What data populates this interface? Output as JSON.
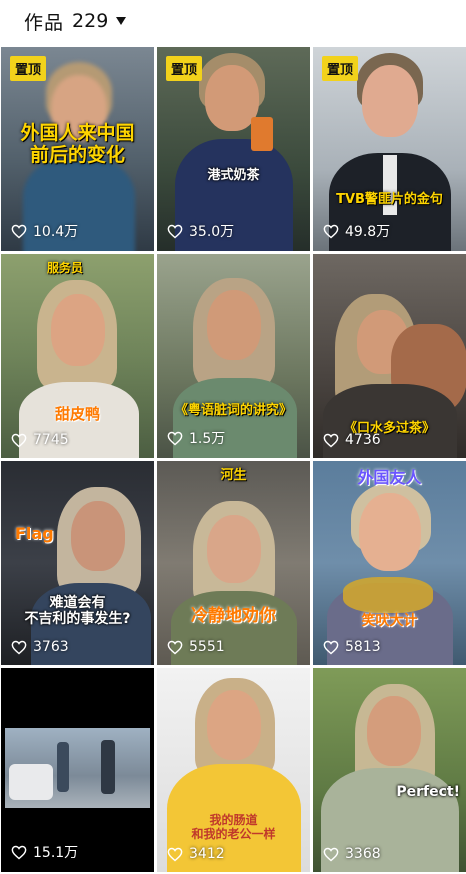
{
  "header": {
    "label": "作品",
    "count": "229"
  },
  "tiles": [
    {
      "pinned": true,
      "pin_label": "置顶",
      "caption": "外国人来中国\n前后的变化",
      "likes": "10.4万"
    },
    {
      "pinned": true,
      "pin_label": "置顶",
      "caption": "港式奶茶",
      "likes": "35.0万"
    },
    {
      "pinned": true,
      "pin_label": "置顶",
      "caption": "TVB警匪片的金句",
      "likes": "49.8万"
    },
    {
      "pinned": false,
      "caption": "服务员",
      "caption2": "甜皮鸭",
      "likes": "7745"
    },
    {
      "pinned": false,
      "caption": "《粤语脏词的讲究》",
      "likes": "1.5万"
    },
    {
      "pinned": false,
      "caption": "《口水多过茶》",
      "likes": "4736"
    },
    {
      "pinned": false,
      "caption": "Flag",
      "caption2": "难道会有\n不吉利的事发生?",
      "likes": "3763"
    },
    {
      "pinned": false,
      "caption": "河生",
      "caption2": "冷静地劝你",
      "likes": "5551"
    },
    {
      "pinned": false,
      "caption": "外国友人",
      "caption2": "笑吠大计",
      "likes": "5813"
    },
    {
      "pinned": false,
      "caption": "",
      "likes": "15.1万"
    },
    {
      "pinned": false,
      "caption": "我的肠道\n和我的老公一样",
      "likes": "3412"
    },
    {
      "pinned": false,
      "caption": "Perfect!",
      "likes": "3368"
    }
  ]
}
